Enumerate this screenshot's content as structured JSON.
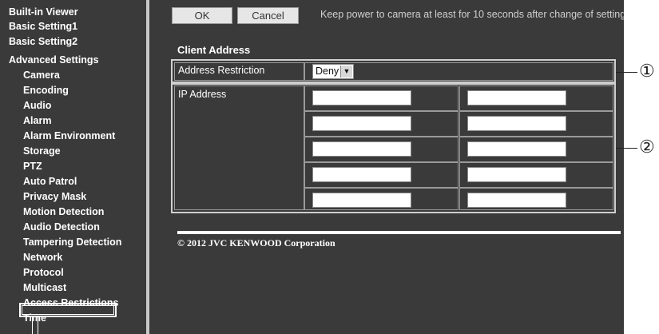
{
  "sidebar": {
    "items": [
      {
        "label": "Built-in Viewer",
        "level": "top"
      },
      {
        "label": "Basic Setting1",
        "level": "top"
      },
      {
        "label": "Basic Setting2",
        "level": "top"
      },
      {
        "label": "Advanced Settings",
        "level": "top"
      },
      {
        "label": "Camera",
        "level": "sub"
      },
      {
        "label": "Encoding",
        "level": "sub"
      },
      {
        "label": "Audio",
        "level": "sub"
      },
      {
        "label": "Alarm",
        "level": "sub"
      },
      {
        "label": "Alarm Environment",
        "level": "sub"
      },
      {
        "label": "Storage",
        "level": "sub"
      },
      {
        "label": "PTZ",
        "level": "sub"
      },
      {
        "label": "Auto Patrol",
        "level": "sub"
      },
      {
        "label": "Privacy Mask",
        "level": "sub"
      },
      {
        "label": "Motion Detection",
        "level": "sub"
      },
      {
        "label": "Audio Detection",
        "level": "sub"
      },
      {
        "label": "Tampering Detection",
        "level": "sub"
      },
      {
        "label": "Network",
        "level": "sub"
      },
      {
        "label": "Protocol",
        "level": "sub"
      },
      {
        "label": "Multicast",
        "level": "sub"
      },
      {
        "label": "Access Restrictions",
        "level": "sub",
        "selected": true
      },
      {
        "label": "Time",
        "level": "sub"
      }
    ]
  },
  "toolbar": {
    "ok_label": "OK",
    "cancel_label": "Cancel",
    "notice": "Keep power to camera at least for 10 seconds after change of setting"
  },
  "section": {
    "title": "Client Address",
    "address_restriction_label": "Address Restriction",
    "address_restriction_value": "Deny",
    "ip_address_label": "IP Address",
    "ip_rows": [
      [
        "",
        ""
      ],
      [
        "",
        ""
      ],
      [
        "",
        ""
      ],
      [
        "",
        ""
      ],
      [
        "",
        ""
      ]
    ]
  },
  "footer": {
    "copyright": "© 2012 JVC KENWOOD Corporation"
  },
  "callouts": [
    "①",
    "②"
  ]
}
